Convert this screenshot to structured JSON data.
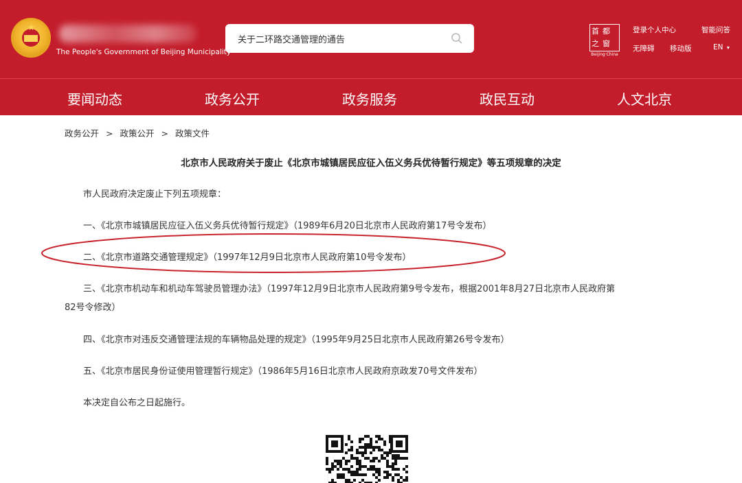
{
  "header": {
    "logo_en": "The People's Government of Beijing Municipality",
    "search": {
      "value": "关于二环路交通管理的通告"
    },
    "capital": {
      "chars": [
        "首",
        "都",
        "之",
        "窗"
      ],
      "sub": "Beijing·China"
    },
    "links": {
      "login": "登录个人中心",
      "smart_qa": "智能问答",
      "accessible": "无障碍",
      "mobile": "移动版",
      "language": "EN"
    }
  },
  "nav": {
    "items": [
      "要闻动态",
      "政务公开",
      "政务服务",
      "政民互动",
      "人文北京"
    ]
  },
  "breadcrumb": [
    "政务公开",
    "政策公开",
    "政策文件"
  ],
  "breadcrumb_sep": ">",
  "document": {
    "title": "北京市人民政府关于废止《北京市城镇居民应征入伍义务兵优待暂行规定》等五项规章的决定",
    "intro": "市人民政府决定废止下列五项规章：",
    "items": [
      "一、《北京市城镇居民应征入伍义务兵优待暂行规定》（1989年6月20日北京市人民政府第17号令发布）",
      "二、《北京市道路交通管理规定》（1997年12月9日北京市人民政府第10号令发布）",
      "三、《北京市机动车和机动车驾驶员管理办法》（1997年12月9日北京市人民政府第9号令发布，根据2001年8月27日北京市人民政府第",
      "82号令修改）",
      "四、《北京市对违反交通管理法规的车辆物品处理的规定》（1995年9月25日北京市人民政府第26号令发布）",
      "五、《北京市居民身份证使用管理暂行规定》（1986年5月16日北京市人民政府京政发70号文件发布）"
    ],
    "closing": "本决定自公布之日起施行。"
  },
  "colors": {
    "brand_red": "#c31c2a",
    "annotation_red": "#c8232d"
  }
}
